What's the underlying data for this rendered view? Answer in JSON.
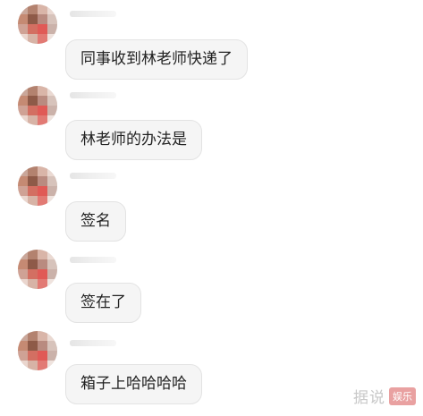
{
  "messages": [
    {
      "text": "同事收到林老师快递了"
    },
    {
      "text": "林老师的办法是"
    },
    {
      "text": "签名"
    },
    {
      "text": "签在了"
    },
    {
      "text": "箱子上哈哈哈哈"
    }
  ],
  "watermark": {
    "text": "据说",
    "badge": "娱乐"
  },
  "colors": {
    "background": "#ffffff",
    "bubble": "#f5f5f5",
    "bubble_border": "#e3e3e3",
    "text": "#222222"
  }
}
